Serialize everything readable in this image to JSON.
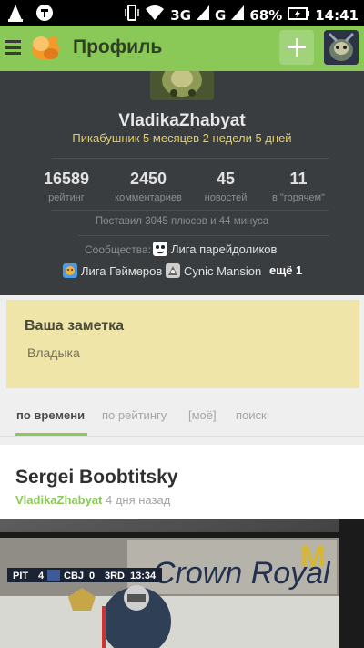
{
  "status_bar": {
    "network": "3G",
    "carrier_marker": "G",
    "battery": "68%",
    "time": "14:41",
    "icons": [
      "vlc-icon",
      "torrent-icon",
      "vibrate-icon",
      "wifi-icon",
      "signal-icon",
      "battery-icon"
    ]
  },
  "app_bar": {
    "title": "Профиль",
    "accent": "#8ac858"
  },
  "profile": {
    "username": "VladikaZhabyat",
    "member_since": "Пикабушник 5 месяцев 2 недели 5 дней",
    "stats": [
      {
        "value": "16589",
        "label": "рейтинг"
      },
      {
        "value": "2450",
        "label": "комментариев"
      },
      {
        "value": "45",
        "label": "новостей"
      },
      {
        "value": "11",
        "label": "в \"горячем\""
      }
    ],
    "votes_summary": "Поставил 3045 плюсов и 44 минуса",
    "communities_label": "Сообщества:",
    "communities": [
      {
        "name": "Лига парейдоликов",
        "icon": "pareidolia-community-icon"
      },
      {
        "name": "Лига Геймеров",
        "icon": "gamers-community-icon"
      },
      {
        "name": "Cynic Mansion",
        "icon": "cynic-mansion-community-icon"
      }
    ],
    "more": "ещё 1"
  },
  "note": {
    "title": "Ваша заметка",
    "text": "Владыка"
  },
  "tabs": [
    {
      "label": "по времени",
      "active": true
    },
    {
      "label": "по рейтингу",
      "active": false
    },
    {
      "label": "[моё]",
      "active": false
    },
    {
      "label": "поиск",
      "active": false
    }
  ],
  "post": {
    "title": "Sergei Boobtitsky",
    "author": "VladikaZhabyat",
    "time": "4 дня назад",
    "image_scoreboard": {
      "team1": "PIT",
      "score1": "4",
      "team2": "CBJ",
      "score2": "0",
      "period": "3RD",
      "clock": "13:34"
    },
    "image_ad_text": "Crown Royal"
  }
}
